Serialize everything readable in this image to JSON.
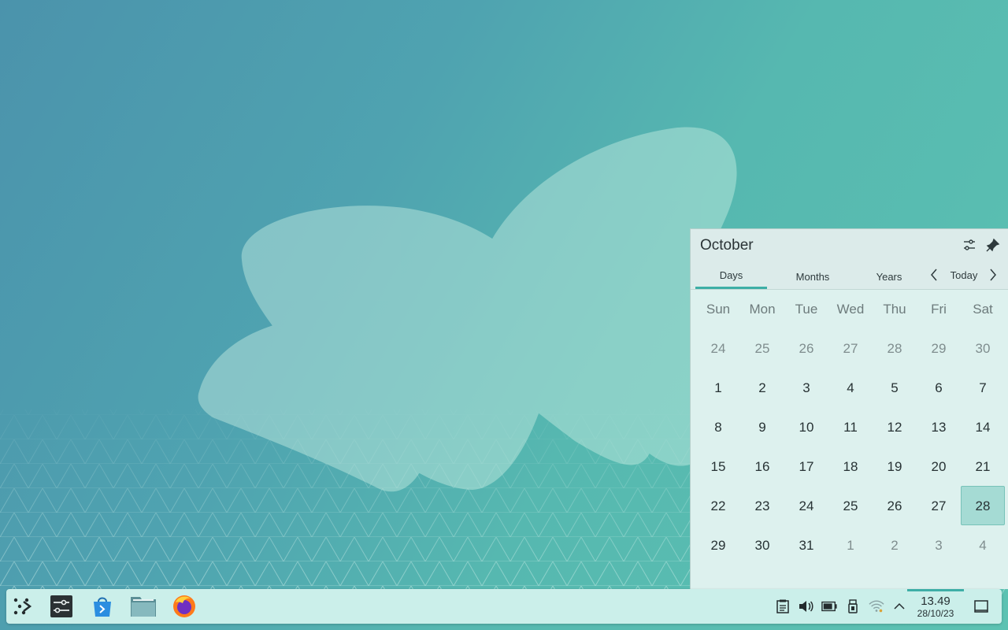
{
  "calendar": {
    "month": "October",
    "tabs": [
      "Days",
      "Months",
      "Years"
    ],
    "today_label": "Today",
    "weekdays": [
      "Sun",
      "Mon",
      "Tue",
      "Wed",
      "Thu",
      "Fri",
      "Sat"
    ],
    "weeks": [
      [
        "24",
        "25",
        "26",
        "27",
        "28",
        "29",
        "30"
      ],
      [
        "1",
        "2",
        "3",
        "4",
        "5",
        "6",
        "7"
      ],
      [
        "8",
        "9",
        "10",
        "11",
        "12",
        "13",
        "14"
      ],
      [
        "15",
        "16",
        "17",
        "18",
        "19",
        "20",
        "21"
      ],
      [
        "22",
        "23",
        "24",
        "25",
        "26",
        "27",
        "28"
      ],
      [
        "29",
        "30",
        "31",
        "1",
        "2",
        "3",
        "4"
      ]
    ]
  },
  "taskbar": {
    "apps": [
      {
        "icon": "app-launcher-icon"
      },
      {
        "icon": "system-settings-icon"
      },
      {
        "icon": "discover-store-icon"
      },
      {
        "icon": "file-manager-icon"
      },
      {
        "icon": "firefox-icon"
      }
    ],
    "tray": [
      {
        "icon": "clipboard-icon"
      },
      {
        "icon": "volume-icon"
      },
      {
        "icon": "battery-icon"
      },
      {
        "icon": "usb-device-icon"
      },
      {
        "icon": "wifi-icon"
      },
      {
        "icon": "chevron-up-icon"
      }
    ],
    "clock": {
      "time": "13.49",
      "date": "28/10/23"
    }
  },
  "colors": {
    "accent": "#3daea6",
    "today_bg": "#a5dbd4",
    "taskbar_bg": "#cbefea",
    "popup_bg": "#ddf1ee"
  }
}
